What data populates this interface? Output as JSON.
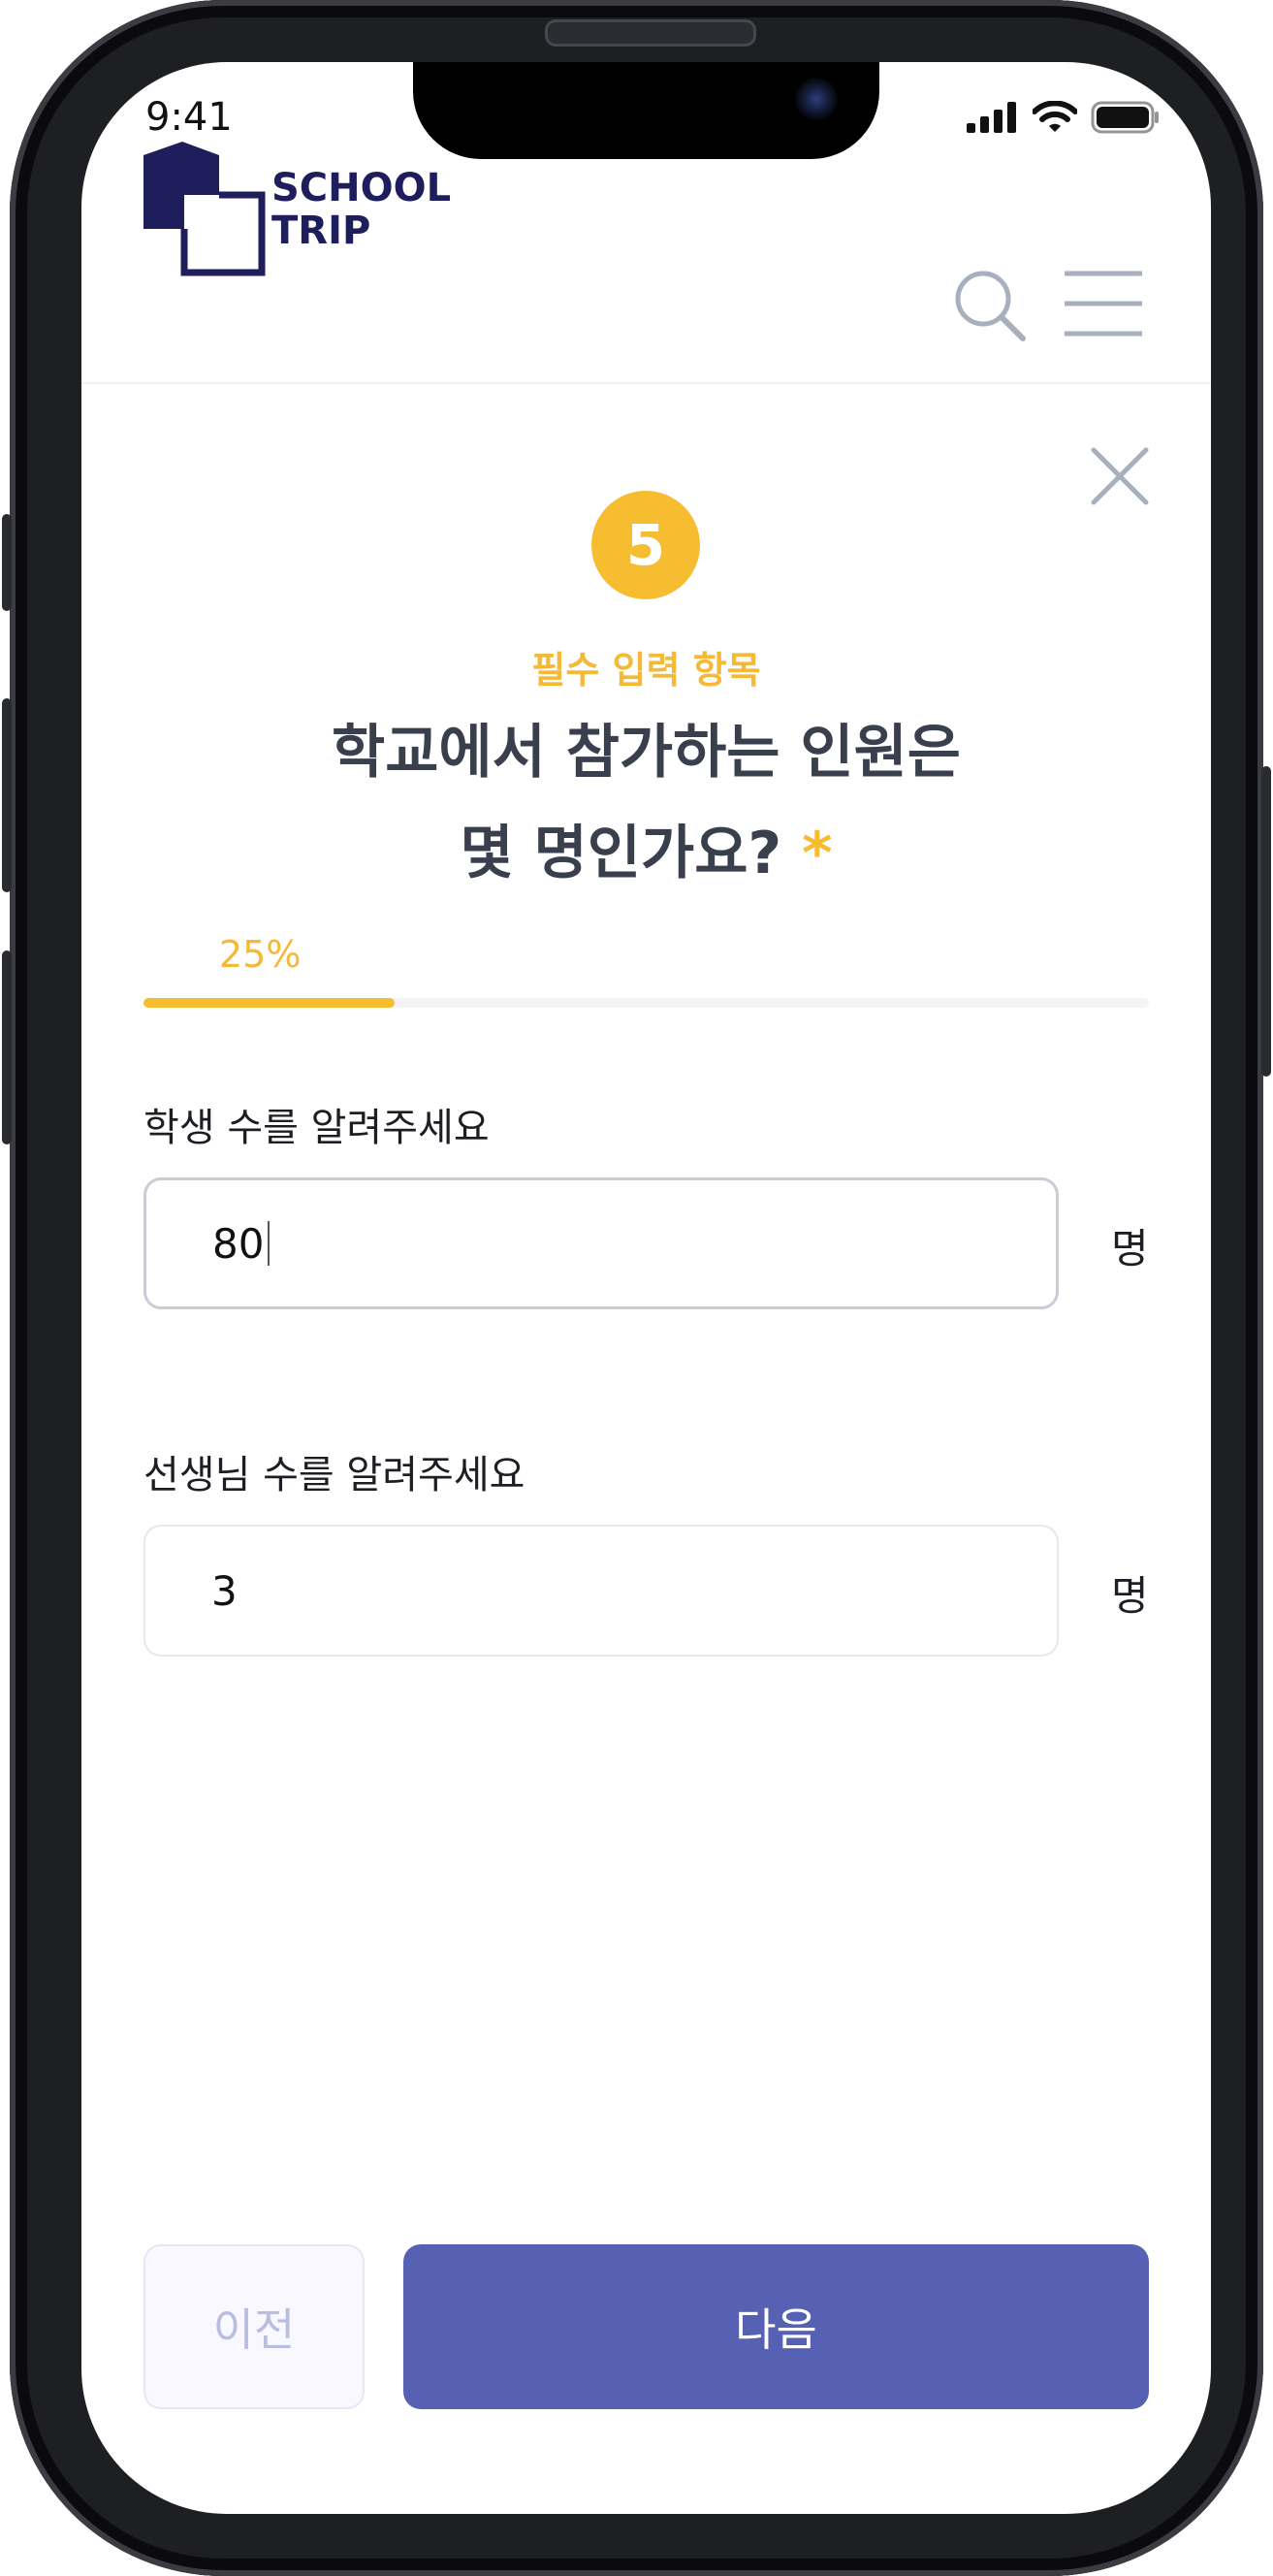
{
  "status_bar": {
    "time": "9:41"
  },
  "brand": {
    "line1": "SCHOOL",
    "line2": "TRIP",
    "color": "#1f1e5c"
  },
  "step": {
    "number": "5",
    "required_label": "필수 입력 항목"
  },
  "question": {
    "line1": "학교에서 참가하는 인원은",
    "line2": "몇 명인가요?",
    "required_mark": "*"
  },
  "progress": {
    "label": "25%",
    "value": 0.25,
    "accent": "#f7bd31"
  },
  "fields": [
    {
      "label": "학생 수를 알려주세요",
      "value": "80",
      "unit": "명"
    },
    {
      "label": "선생님 수를 알려주세요",
      "value": "3",
      "unit": "명"
    }
  ],
  "buttons": {
    "prev": "이전",
    "next": "다음",
    "next_color": "#5761b4"
  },
  "icons": [
    "search-icon",
    "menu-icon",
    "close-icon"
  ]
}
